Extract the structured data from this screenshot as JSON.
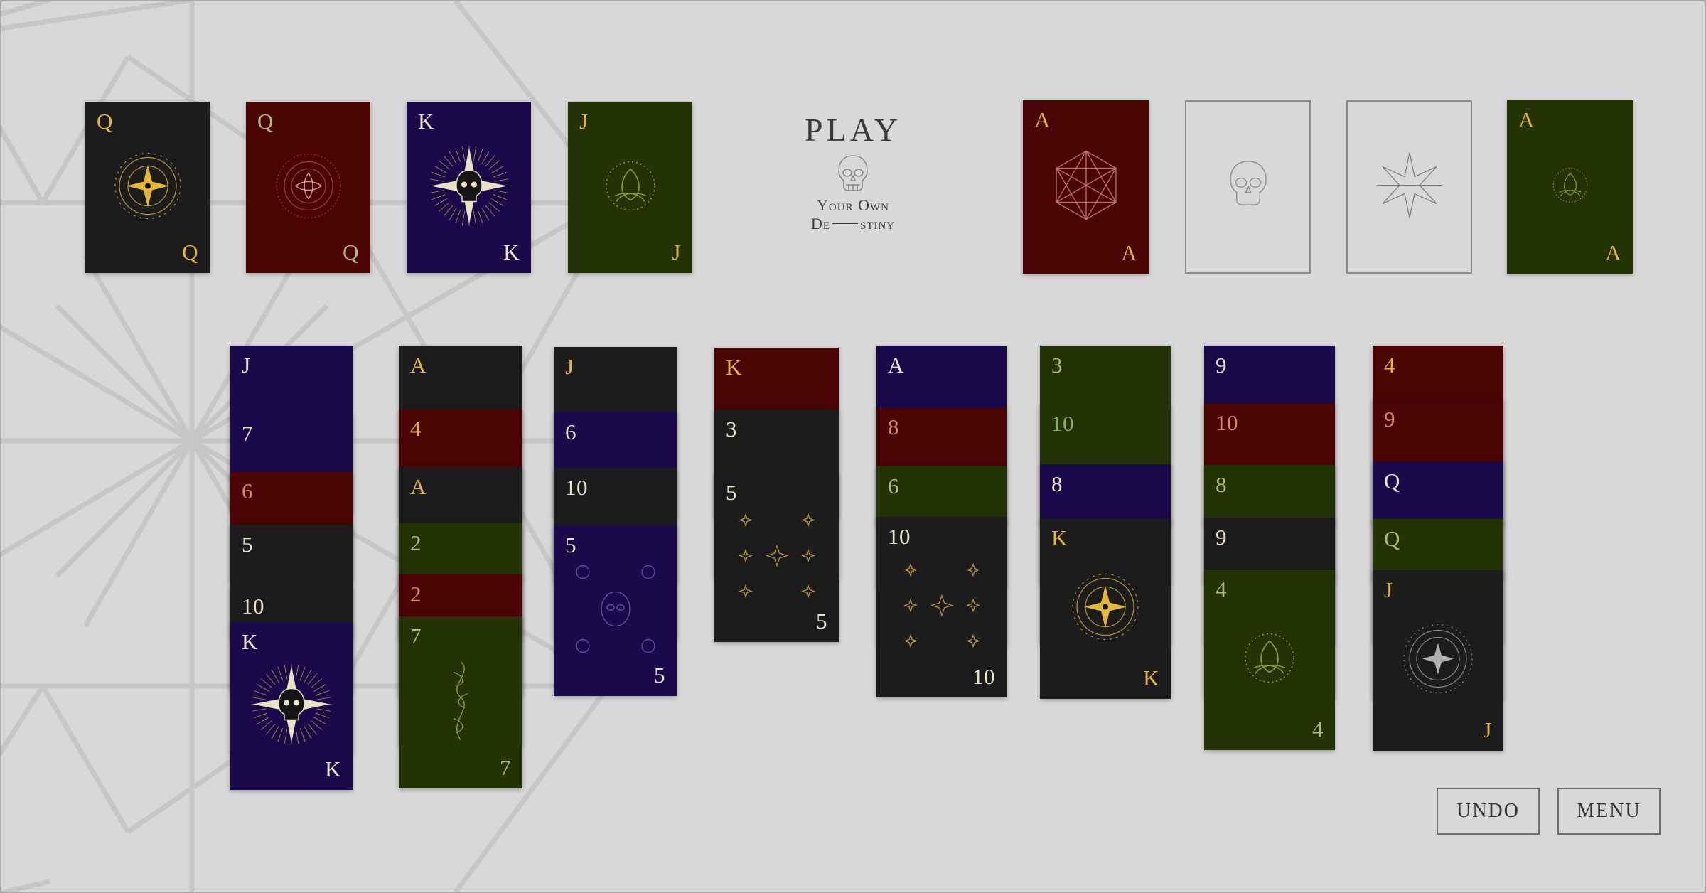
{
  "title": {
    "play": "PLAY",
    "subtitle_line1": "Your Own",
    "subtitle_line2": "De",
    "subtitle_line2_end": "stiny"
  },
  "buttons": {
    "undo": "UNDO",
    "menu": "MENU"
  },
  "colors": {
    "background": "#d8d8d8",
    "black": "#1c1c1c",
    "red": "#4a0404",
    "purple": "#1b0a4b",
    "green": "#233306",
    "gold": "#e3b737",
    "ivory": "#ece5cc",
    "salmon": "#d98a64",
    "sage": "#b2bb7b",
    "lightgreen": "#8ab05a"
  },
  "foundations": [
    {
      "rank": "Q",
      "suit": "black",
      "ink": "gold",
      "art": "compass-star"
    },
    {
      "rank": "Q",
      "suit": "red",
      "ink": "sage",
      "art": "rose"
    },
    {
      "rank": "K",
      "suit": "purple",
      "ink": "ivory",
      "art": "skull-star"
    },
    {
      "rank": "J",
      "suit": "green",
      "ink": "gold",
      "art": "triquetra"
    }
  ],
  "suit_slots": [
    {
      "rank": "A",
      "suit": "red",
      "ink": "gold",
      "art": "hexagram",
      "empty": false
    },
    {
      "rank": "",
      "suit": "empty",
      "ink": "ivory",
      "art": "skull-outline",
      "empty": true
    },
    {
      "rank": "",
      "suit": "empty",
      "ink": "ivory",
      "art": "star-outline",
      "empty": true
    },
    {
      "rank": "A",
      "suit": "green",
      "ink": "gold",
      "art": "triquetra-small",
      "empty": false
    }
  ],
  "tableau": [
    {
      "column": 1,
      "cards": [
        {
          "rank": "J",
          "suit": "purple",
          "ink": "ivory"
        },
        {
          "rank": "7",
          "suit": "purple",
          "ink": "ivory"
        },
        {
          "rank": "6",
          "suit": "red",
          "ink": "salmon"
        },
        {
          "rank": "5",
          "suit": "black",
          "ink": "ivory"
        },
        {
          "rank": "10",
          "suit": "black",
          "ink": "ivory"
        },
        {
          "rank": "K",
          "suit": "purple",
          "ink": "ivory",
          "art": "skull-star"
        }
      ]
    },
    {
      "column": 2,
      "cards": [
        {
          "rank": "A",
          "suit": "black",
          "ink": "gold"
        },
        {
          "rank": "4",
          "suit": "red",
          "ink": "gold"
        },
        {
          "rank": "A",
          "suit": "black",
          "ink": "gold"
        },
        {
          "rank": "2",
          "suit": "green",
          "ink": "sage"
        },
        {
          "rank": "2",
          "suit": "red",
          "ink": "salmon"
        },
        {
          "rank": "7",
          "suit": "green",
          "ink": "sage",
          "art": "vine"
        }
      ]
    },
    {
      "column": 3,
      "cards": [
        {
          "rank": "J",
          "suit": "black",
          "ink": "gold"
        },
        {
          "rank": "6",
          "suit": "purple",
          "ink": "ivory"
        },
        {
          "rank": "10",
          "suit": "black",
          "ink": "ivory"
        },
        {
          "rank": "5",
          "suit": "purple",
          "ink": "ivory",
          "art": "skulls"
        }
      ]
    },
    {
      "column": 4,
      "cards": [
        {
          "rank": "K",
          "suit": "red",
          "ink": "gold"
        },
        {
          "rank": "3",
          "suit": "black",
          "ink": "ivory"
        },
        {
          "rank": "5",
          "suit": "black",
          "ink": "ivory",
          "art": "stars"
        }
      ]
    },
    {
      "column": 5,
      "cards": [
        {
          "rank": "A",
          "suit": "purple",
          "ink": "ivory"
        },
        {
          "rank": "8",
          "suit": "red",
          "ink": "salmon"
        },
        {
          "rank": "6",
          "suit": "green",
          "ink": "sage"
        },
        {
          "rank": "10",
          "suit": "black",
          "ink": "ivory",
          "art": "stars"
        }
      ]
    },
    {
      "column": 6,
      "cards": [
        {
          "rank": "3",
          "suit": "green",
          "ink": "sage"
        },
        {
          "rank": "10",
          "suit": "green",
          "ink": "lightgreen"
        },
        {
          "rank": "8",
          "suit": "purple",
          "ink": "ivory"
        },
        {
          "rank": "K",
          "suit": "black",
          "ink": "gold",
          "art": "compass-star"
        }
      ]
    },
    {
      "column": 7,
      "cards": [
        {
          "rank": "9",
          "suit": "purple",
          "ink": "ivory"
        },
        {
          "rank": "10",
          "suit": "red",
          "ink": "salmon"
        },
        {
          "rank": "8",
          "suit": "green",
          "ink": "sage"
        },
        {
          "rank": "9",
          "suit": "black",
          "ink": "ivory"
        },
        {
          "rank": "4",
          "suit": "green",
          "ink": "sage",
          "art": "triquetra"
        }
      ]
    },
    {
      "column": 8,
      "cards": [
        {
          "rank": "4",
          "suit": "red",
          "ink": "gold"
        },
        {
          "rank": "9",
          "suit": "red",
          "ink": "salmon"
        },
        {
          "rank": "Q",
          "suit": "purple",
          "ink": "ivory"
        },
        {
          "rank": "Q",
          "suit": "green",
          "ink": "sage"
        },
        {
          "rank": "J",
          "suit": "black",
          "ink": "gold",
          "art": "compass"
        }
      ]
    }
  ]
}
